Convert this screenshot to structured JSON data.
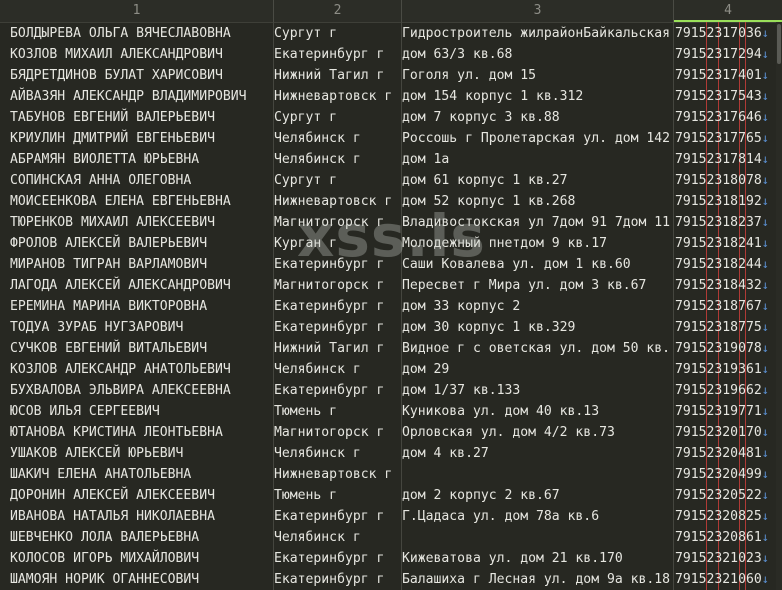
{
  "columns": [
    "1",
    "2",
    "3",
    "4"
  ],
  "watermark": "xss.is",
  "colors": {
    "background": "#272822",
    "text": "#e6e6e0",
    "header_text": "#8d8d86",
    "active_column_accent": "#9ae05a",
    "ruler_lines": "#b03a36",
    "arrow": "#5a8fd0"
  },
  "arrow_glyph": "↓",
  "rows": [
    [
      "БОЛДЫРЕВА ОЛЬГА ВЯЧЕСЛАВОВНА",
      "Сургут г",
      "Гидростроитель жилрайонБайкальская",
      "79152317036"
    ],
    [
      "КОЗЛОВ МИХАИЛ АЛЕКСАНДРОВИЧ",
      "Екатеринбург г",
      "дом 63/3 кв.68",
      "79152317294"
    ],
    [
      "БЯДРЕТДИНОВ БУЛАТ ХАРИСОВИЧ",
      "Нижний Тагил г",
      "Гоголя ул. дом 15",
      "79152317401"
    ],
    [
      "АЙВАЗЯН АЛЕКСАНДР ВЛАДИМИРОВИЧ",
      "Нижневартовск г",
      "дом 154 корпус 1 кв.312",
      "79152317543"
    ],
    [
      "ТАБУНОВ ЕВГЕНИЙ ВАЛЕРЬЕВИЧ",
      "Сургут г",
      "дом 7 корпус 3 кв.88",
      "79152317646"
    ],
    [
      "КРИУЛИН ДМИТРИЙ ЕВГЕНЬЕВИЧ",
      "Челябинск г",
      "Россошь г Пролетарская ул. дом 142",
      "79152317765"
    ],
    [
      "АБРАМЯН ВИОЛЕТТА ЮРЬЕВНА",
      "Челябинск г",
      "дом 1а",
      "79152317814"
    ],
    [
      "СОПИНСКАЯ АННА ОЛЕГОВНА",
      "Сургут г",
      "дом 61 корпус 1 кв.27",
      "79152318078"
    ],
    [
      "МОИСЕЕНКОВА ЕЛЕНА ЕВГЕНЬЕВНА",
      "Нижневартовск г",
      "дом 52 корпус 1 кв.268",
      "79152318192"
    ],
    [
      "ТЮРЕНКОВ МИХАИЛ АЛЕКСЕЕВИЧ",
      "Магнитогорск г",
      "Владивостокская ул 7дом 91 7дом 11",
      "79152318237"
    ],
    [
      "ФРОЛОВ АЛЕКСЕЙ ВАЛЕРЬЕВИЧ",
      "Курган г",
      "Молодежный пнетдом 9 кв.17",
      "79152318241"
    ],
    [
      "МИРАНОВ ТИГРАН ВАРЛАМОВИЧ",
      "Екатеринбург г",
      "Саши Ковалева ул. дом 1 кв.60",
      "79152318244"
    ],
    [
      "ЛАГОДА АЛЕКСЕЙ АЛЕКСАНДРОВИЧ",
      "Магнитогорск г",
      "Пересвет г Мира ул. дом 3 кв.67",
      "79152318432"
    ],
    [
      "ЕРЕМИНА МАРИНА ВИКТОРОВНА",
      "Екатеринбург г",
      "дом 33 корпус 2",
      "79152318767"
    ],
    [
      "ТОДУА ЗУРАБ НУГЗАРОВИЧ",
      "Екатеринбург г",
      "дом 30 корпус 1 кв.329",
      "79152318775"
    ],
    [
      "СУЧКОВ ЕВГЕНИЙ ВИТАЛЬЕВИЧ",
      "Нижний Тагил г",
      "Видное г с оветская ул. дом 50 кв.",
      "79152319078"
    ],
    [
      "КОЗЛОВ АЛЕКСАНДР АНАТОЛЬЕВИЧ",
      "Челябинск г",
      "дом 29",
      "79152319361"
    ],
    [
      "БУХВАЛОВА ЭЛЬВИРА АЛЕКСЕЕВНА",
      "Екатеринбург г",
      "дом 1/37 кв.133",
      "79152319662"
    ],
    [
      "ЮСОВ ИЛЬЯ СЕРГЕЕВИЧ",
      "Тюмень г",
      "Куникова ул. дом 40 кв.13",
      "79152319771"
    ],
    [
      "ЮТАНОВА КРИСТИНА ЛЕОНТЬЕВНА",
      "Магнитогорск г",
      "Орловская ул. дом 4/2 кв.73",
      "79152320170"
    ],
    [
      "УШАКОВ АЛЕКСЕЙ ЮРЬЕВИЧ",
      "Челябинск г",
      "дом 4 кв.27",
      "79152320481"
    ],
    [
      "ШАКИЧ ЕЛЕНА АНАТОЛЬЕВНА",
      "Нижневартовск г",
      "",
      "79152320499"
    ],
    [
      "ДОРОНИН АЛЕКСЕЙ АЛЕКСЕЕВИЧ",
      "Тюмень г",
      "дом 2 корпус 2 кв.67",
      "79152320522"
    ],
    [
      "ИВАНОВА НАТАЛЬЯ НИКОЛАЕВНА",
      "Екатеринбург г",
      "Г.Цадаса ул. дом 78а кв.6",
      "79152320825"
    ],
    [
      "ШЕВЧЕНКО ЛОЛА ВАЛЕРЬЕВНА",
      "Челябинск г",
      "",
      "79152320861"
    ],
    [
      "КОЛОСОВ ИГОРЬ МИХАЙЛОВИЧ",
      "Екатеринбург г",
      "Кижеватова ул. дом 21 кв.170",
      "79152321023"
    ],
    [
      "ШАМОЯН НОРИК ОГАННЕСОВИЧ",
      "Екатеринбург г",
      "Балашиха г Лесная ул. дом 9а кв.18",
      "79152321060"
    ]
  ]
}
